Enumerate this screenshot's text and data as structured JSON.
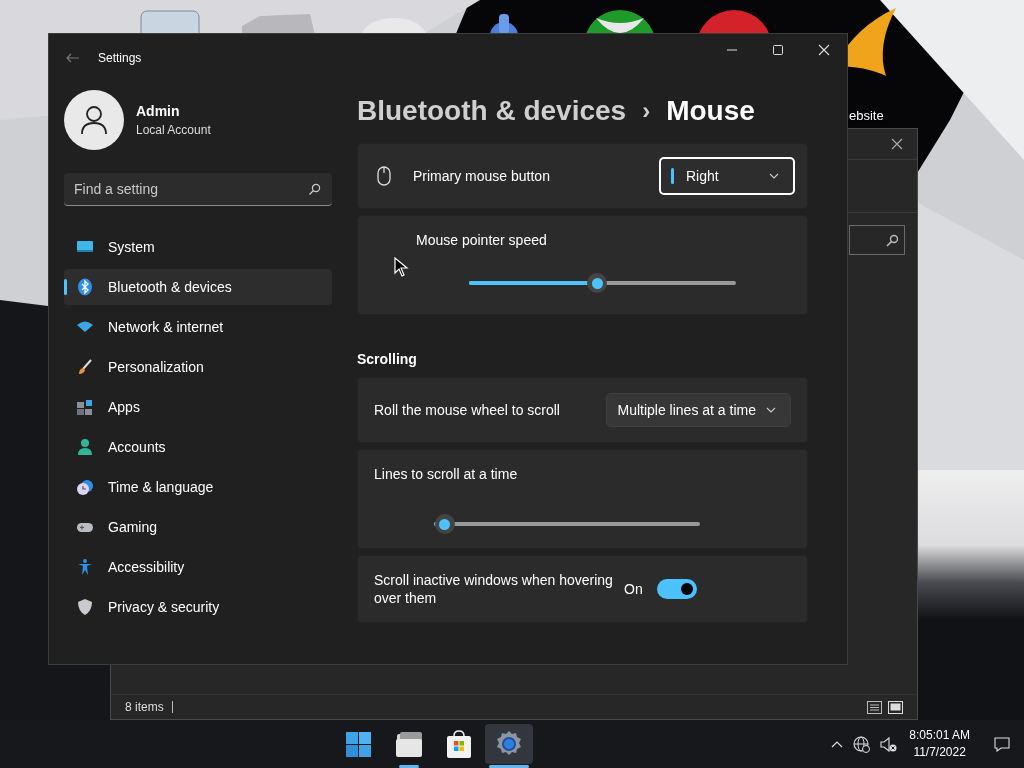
{
  "desktop": {
    "icon_label": "ebsite"
  },
  "background_window": {
    "status": "8 items"
  },
  "window": {
    "title": "Settings"
  },
  "account": {
    "name": "Admin",
    "type": "Local Account"
  },
  "search": {
    "placeholder": "Find a setting"
  },
  "nav": [
    {
      "label": "System",
      "selected": false
    },
    {
      "label": "Bluetooth & devices",
      "selected": true
    },
    {
      "label": "Network & internet",
      "selected": false
    },
    {
      "label": "Personalization",
      "selected": false
    },
    {
      "label": "Apps",
      "selected": false
    },
    {
      "label": "Accounts",
      "selected": false
    },
    {
      "label": "Time & language",
      "selected": false
    },
    {
      "label": "Gaming",
      "selected": false
    },
    {
      "label": "Accessibility",
      "selected": false
    },
    {
      "label": "Privacy & security",
      "selected": false
    }
  ],
  "breadcrumb": {
    "parent": "Bluetooth & devices",
    "separator": "›",
    "current": "Mouse"
  },
  "groups": [
    {
      "rows": [
        {
          "kind": "dropdown",
          "label": "Primary mouse button",
          "value": "Right",
          "focused": true
        },
        {
          "kind": "slider",
          "label": "Mouse pointer speed",
          "level": 0.48
        }
      ]
    },
    {
      "heading": "Scrolling",
      "rows": [
        {
          "kind": "dropdown",
          "label": "Roll the mouse wheel to scroll",
          "value": "Multiple lines at a time",
          "focused": false
        },
        {
          "kind": "slider",
          "label": "Lines to scroll at a time",
          "level": 0.04
        },
        {
          "kind": "toggle",
          "label": "Scroll inactive windows when hovering over them",
          "state_text": "On",
          "on": true
        }
      ]
    }
  ],
  "taskbar": {
    "apps": [
      {
        "kind": "start",
        "running": false,
        "selected": false
      },
      {
        "kind": "files",
        "running": true,
        "selected": false
      },
      {
        "kind": "store",
        "running": false,
        "selected": false
      },
      {
        "kind": "settings",
        "running": true,
        "selected": true
      }
    ],
    "time": "8:05:01 AM",
    "date": "11/7/2022"
  }
}
